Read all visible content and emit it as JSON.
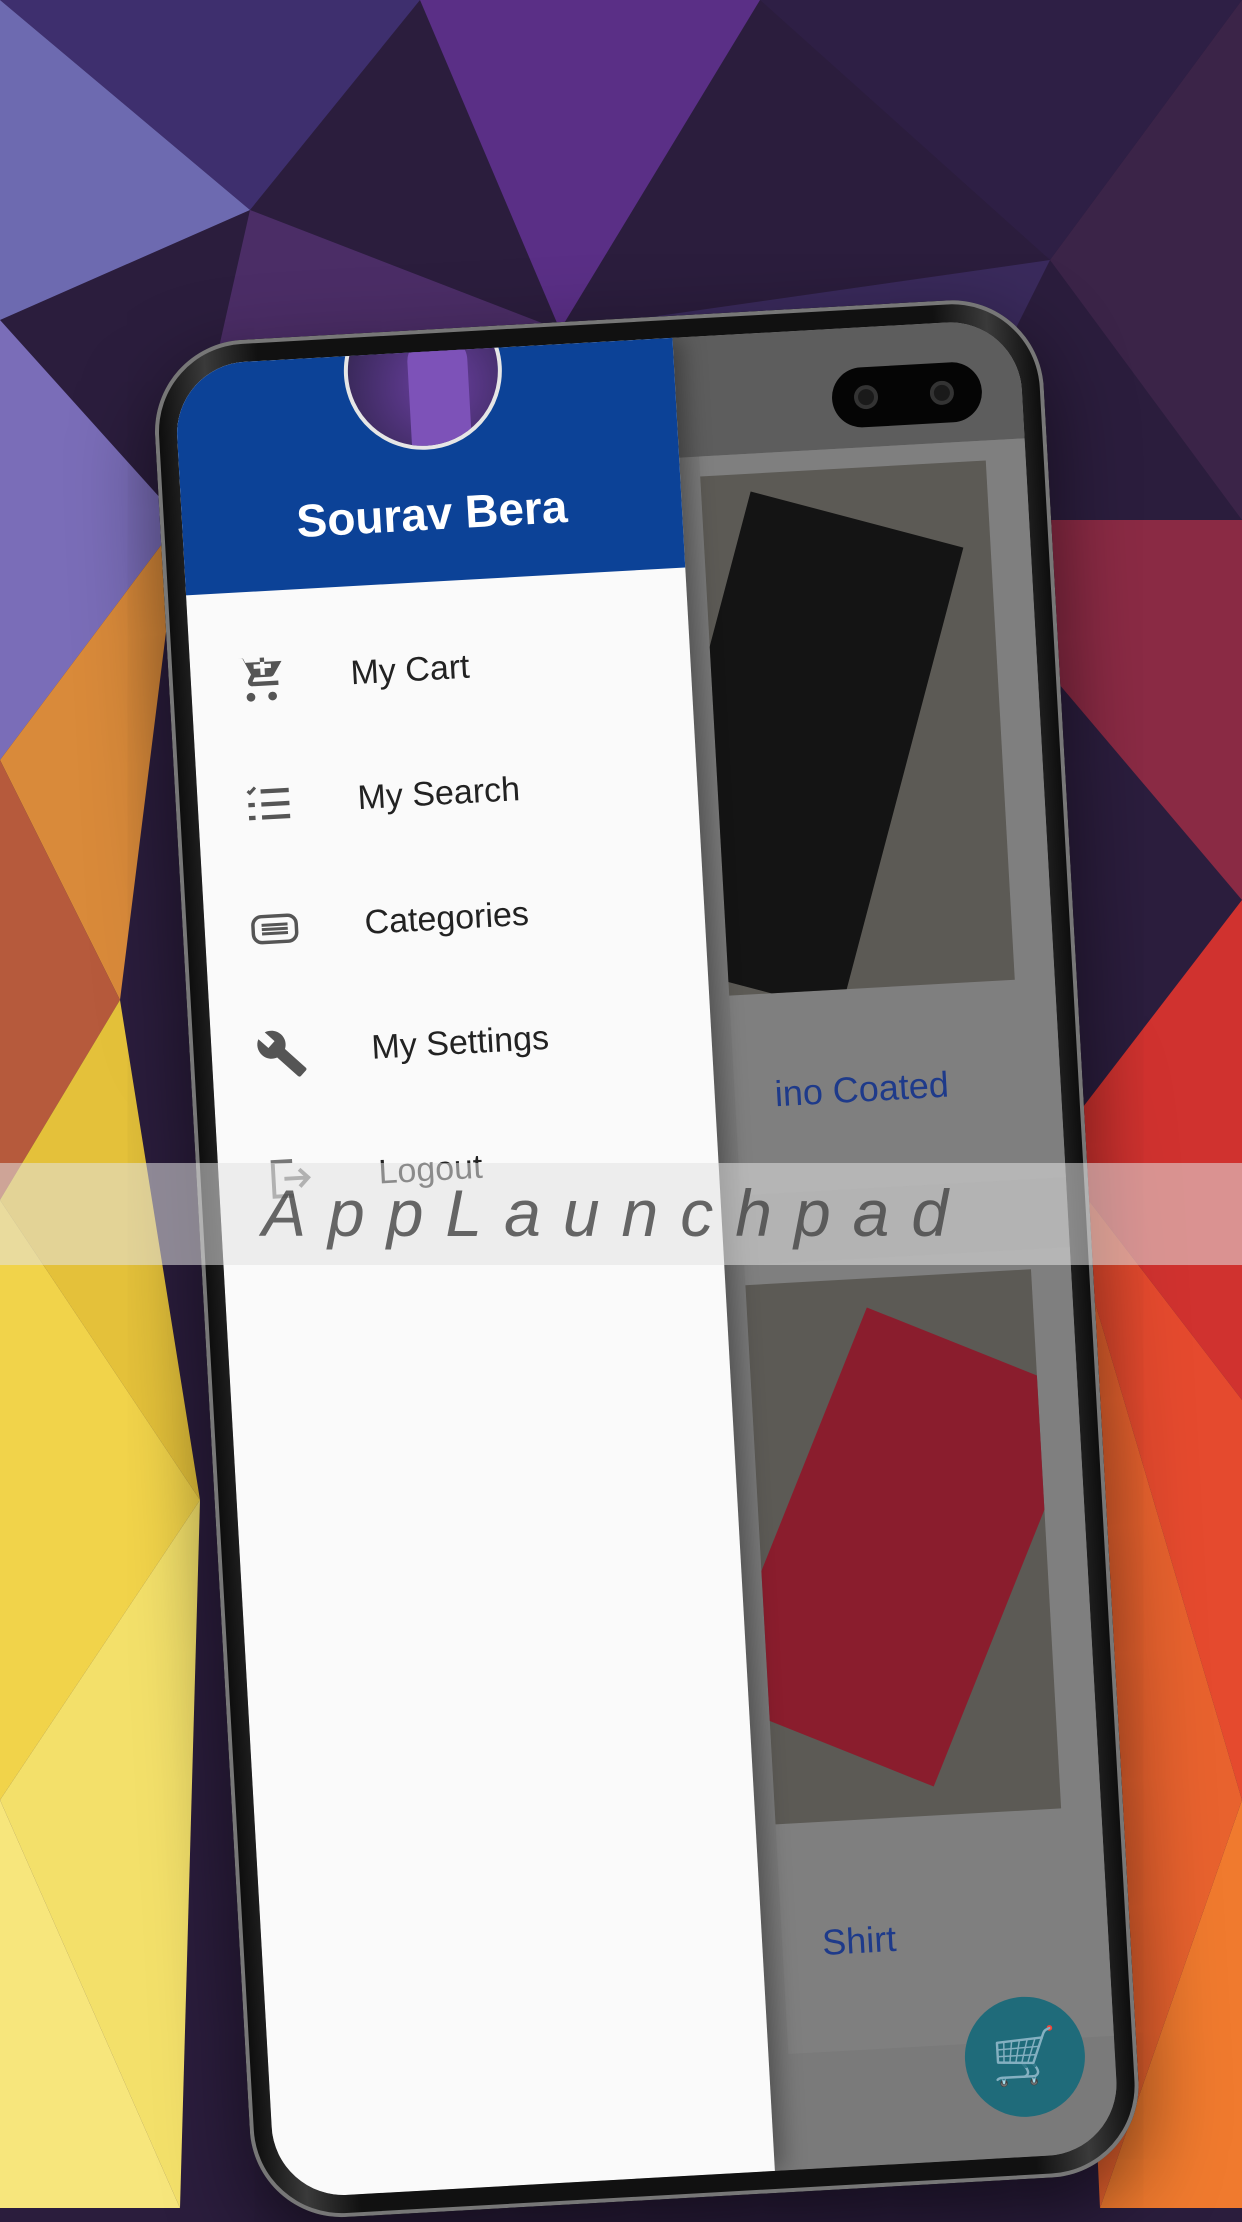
{
  "drawer": {
    "user_name": "Sourav Bera",
    "items": [
      {
        "label": "My Cart",
        "icon": "cart-add-icon"
      },
      {
        "label": "My Search",
        "icon": "checklist-icon"
      },
      {
        "label": "Categories",
        "icon": "category-icon"
      },
      {
        "label": "My Settings",
        "icon": "wrench-icon"
      },
      {
        "label": "Logout",
        "icon": "logout-icon"
      }
    ]
  },
  "background_app": {
    "card1_text": "ino Coated",
    "card2_text": "Shirt",
    "fab_icon": "cart-add-icon"
  },
  "watermark": "AppLaunchpad",
  "colors": {
    "drawer_header": "#0c4297",
    "drawer_bg": "#fafafa",
    "card_text": "#1e3a8a"
  }
}
